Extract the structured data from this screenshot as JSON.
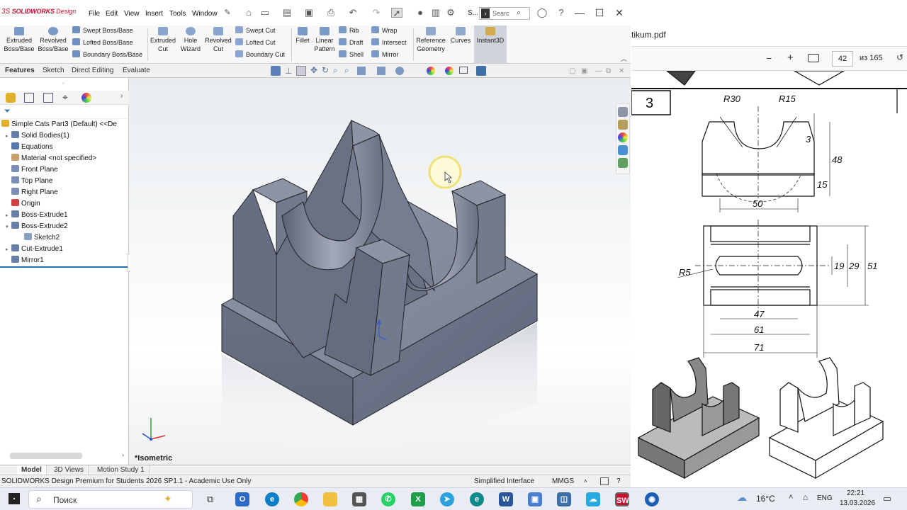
{
  "app": {
    "logo_brand": "SOLIDWORKS",
    "logo_suffix": "Design",
    "menus": [
      "File",
      "Edit",
      "View",
      "Insert",
      "Tools",
      "Window"
    ],
    "search_placeholder": "Searc",
    "s_label": "S..."
  },
  "ribbon": {
    "extruded_boss": "Extruded Boss/Base",
    "revolved_boss": "Revolved Boss/Base",
    "swept_boss": "Swept Boss/Base",
    "lofted_boss": "Lofted Boss/Base",
    "boundary_boss": "Boundary Boss/Base",
    "extruded_cut": "Extruded Cut",
    "hole_wizard": "Hole Wizard",
    "revolved_cut": "Revolved Cut",
    "swept_cut": "Swept Cut",
    "lofted_cut": "Lofted Cut",
    "boundary_cut": "Boundary Cut",
    "fillet": "Fillet",
    "linear_pattern": "Linear Pattern",
    "rib": "Rib",
    "draft": "Draft",
    "shell": "Shell",
    "wrap": "Wrap",
    "intersect": "Intersect",
    "mirror": "Mirror",
    "reference_geometry": "Reference Geometry",
    "curves": "Curves",
    "instant3d": "Instant3D"
  },
  "tabs": [
    "Features",
    "Sketch",
    "Direct Editing",
    "Evaluate"
  ],
  "tree": {
    "root": "Simple Cats Part3 (Default) <<De",
    "items": [
      {
        "label": "Solid Bodies(1)",
        "exp": "▸",
        "color": "#6a7fa8"
      },
      {
        "label": "Equations",
        "exp": "",
        "color": "#5577aa"
      },
      {
        "label": "Material <not specified>",
        "exp": "",
        "color": "#c7a070"
      },
      {
        "label": "Front Plane",
        "exp": "",
        "color": "#7d8fb4"
      },
      {
        "label": "Top Plane",
        "exp": "",
        "color": "#7d8fb4"
      },
      {
        "label": "Right Plane",
        "exp": "",
        "color": "#7d8fb4"
      },
      {
        "label": "Origin",
        "exp": "",
        "color": "#cc4444"
      },
      {
        "label": "Boss-Extrude1",
        "exp": "▸",
        "color": "#6a7fa8"
      },
      {
        "label": "Boss-Extrude2",
        "exp": "▾",
        "color": "#6a7fa8"
      },
      {
        "label": "Cut-Extrude1",
        "exp": "▸",
        "color": "#6a7fa8"
      },
      {
        "label": "Mirror1",
        "exp": "",
        "color": "#6a7fa8"
      }
    ],
    "child": "Sketch2"
  },
  "viewport": {
    "view_label": "*Isometric"
  },
  "bottom_tabs": [
    "Model",
    "3D Views",
    "Motion Study 1"
  ],
  "status": {
    "left": "SOLIDWORKS Design Premium for Students 2026 SP1.1 - Academic Use Only",
    "interface": "Simplified Interface",
    "units": "MMGS"
  },
  "pdf": {
    "filename": "tikum.pdf",
    "page_current": "42",
    "page_total": "из 165",
    "problem_number": "3",
    "dims": {
      "r30": "R30",
      "r15": "R15",
      "d3": "3",
      "d48": "48",
      "d15": "15",
      "d50": "50",
      "r5": "R5",
      "d19": "19",
      "d29": "29",
      "d51": "51",
      "d47": "47",
      "d61": "61",
      "d71": "71"
    }
  },
  "taskbar": {
    "search": "Поиск",
    "weather": "16°C",
    "lang": "ENG",
    "time": "22:21",
    "date": "13.03.2026"
  }
}
